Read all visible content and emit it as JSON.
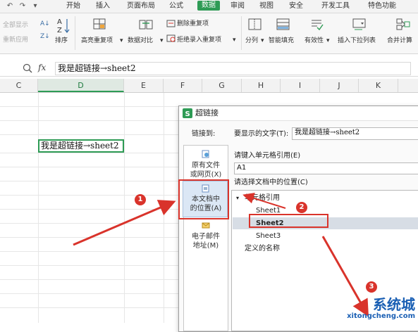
{
  "menubar": {
    "quick_access": [
      "↶",
      "↷",
      "▾"
    ],
    "tabs": [
      "开始",
      "插入",
      "页面布局",
      "公式",
      "数据",
      "审阅",
      "视图",
      "安全",
      "开发工具",
      "特色功能"
    ],
    "active_tab": "数据"
  },
  "ribbon": {
    "show_all": "全部显示",
    "reapply": "重新应用",
    "sort": "排序",
    "highlight_duplicates": "高亮重复项",
    "data_compare": "数据对比",
    "remove_duplicates": "删除重复项",
    "reject_duplicates": "拒绝录入重复项",
    "split_column": "分列",
    "smart_fill": "智能填充",
    "validity": "有效性",
    "insert_dropdown": "插入下拉列表",
    "consolidate": "合并计算"
  },
  "formula_bar": {
    "fx": "fx",
    "content": "我是超链接→sheet2"
  },
  "columns": [
    "C",
    "D",
    "E",
    "F",
    "G",
    "H",
    "I",
    "J",
    "K"
  ],
  "selected_column": "D",
  "cell_d": {
    "value": "我是超链接→sheet2"
  },
  "dialog": {
    "title": "超链接",
    "link_to_label": "链接到:",
    "display_text_label": "要显示的文字(T):",
    "display_text_value": "我是超链接→sheet2",
    "link_options": {
      "existing": "原有文件\n或网页(X)",
      "in_document": "本文档中\n的位置(A)",
      "email": "电子邮件\n地址(M)"
    },
    "cell_ref_label": "请键入单元格引用(E)",
    "cell_ref_value": "A1",
    "location_label": "请选择文档中的位置(C)",
    "tree": {
      "group": "单元格引用",
      "sheets": [
        "Sheet1",
        "Sheet2",
        "Sheet3"
      ],
      "selected": "Sheet2",
      "defined_names": "定义的名称"
    }
  },
  "annotations": {
    "badges": [
      "1",
      "2",
      "3"
    ],
    "color": "#d9332b"
  },
  "watermark": {
    "text": "系统城",
    "url": "xitongcheng.com"
  }
}
